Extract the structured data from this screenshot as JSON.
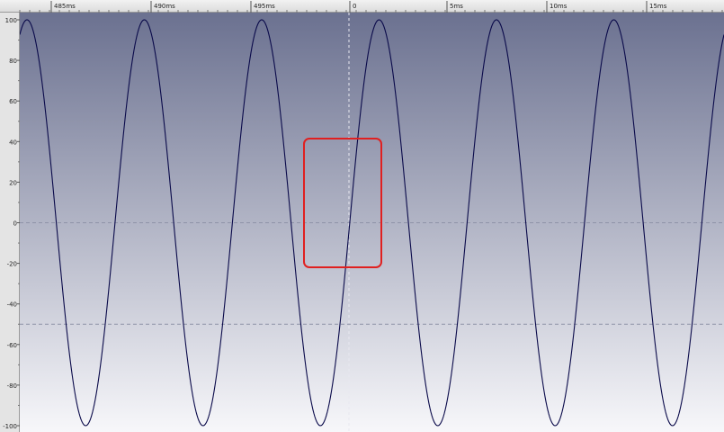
{
  "time_ruler": {
    "labels": [
      "485ms",
      "490ms",
      "495ms",
      "0",
      "5ms",
      "10ms",
      "15ms"
    ],
    "cursor_label": "0"
  },
  "amplitude_ruler": {
    "labels": [
      "100",
      "80",
      "60",
      "40",
      "20",
      "0",
      "-20",
      "-40",
      "-60",
      "-80",
      "-100"
    ]
  },
  "waveform": {
    "type": "sine",
    "amplitude_percent": 100,
    "cycles_visible": 6,
    "line_color": "#0a0a4a",
    "background_top": "#6b7190",
    "background_bottom": "#f7f7fa"
  },
  "grid": {
    "horizontal_lines_at": [
      50,
      0,
      -50
    ],
    "line_color": "#8f93a8"
  },
  "highlight_box": {
    "color": "#e02020"
  }
}
